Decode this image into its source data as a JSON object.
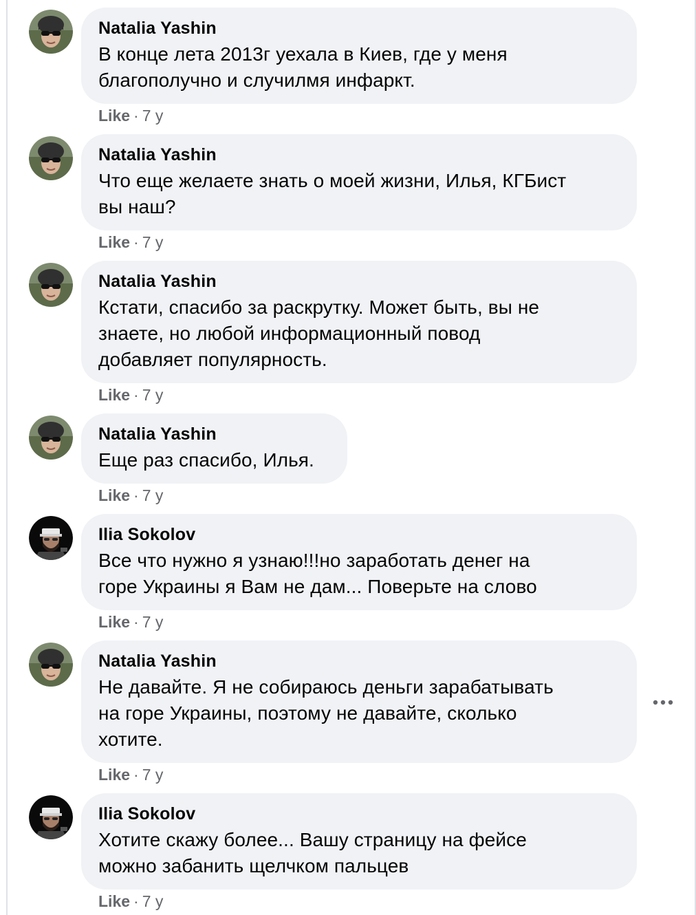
{
  "comments": [
    {
      "author": "Natalia Yashin",
      "text_lines": [
        "В конце лета 2013г уехала в Киев, где у меня",
        "благополучно и случилмя инфаркт."
      ],
      "like": "Like",
      "time": "7 y"
    },
    {
      "author": "Natalia Yashin",
      "text_lines": [
        "Что еще желаете знать о моей жизни, Илья, КГБист",
        "вы наш?"
      ],
      "like": "Like",
      "time": "7 y"
    },
    {
      "author": "Natalia Yashin",
      "text_lines": [
        "Кстати, спасибо за раскрутку. Может быть, вы не",
        "знаете, но любой информационный повод",
        "добавляет популярность."
      ],
      "like": "Like",
      "time": "7 y"
    },
    {
      "author": "Natalia Yashin",
      "text_lines": [
        "Еще раз спасибо, Илья."
      ],
      "like": "Like",
      "time": "7 y"
    },
    {
      "author": "Ilia Sokolov",
      "text_lines": [
        "Все что нужно я узнаю!!!но заработать денег на",
        "горе Украины я Вам не дам... Поверьте на слово"
      ],
      "like": "Like",
      "time": "7 y"
    },
    {
      "author": "Natalia Yashin",
      "text_lines": [
        "Не давайте. Я не собираюсь деньги зарабатывать",
        "на горе Украины, поэтому не давайте, сколько",
        "хотите."
      ],
      "like": "Like",
      "time": "7 y"
    },
    {
      "author": "Ilia Sokolov",
      "text_lines": [
        "Хотите скажу более... Вашу страницу на фейсе",
        "можно забанить щелчком пальцев"
      ],
      "like": "Like",
      "time": "7 y"
    }
  ],
  "separator": "·",
  "more_icon": "more-options-icon",
  "colors": {
    "bubble": "#f0f2f5",
    "text": "#050505",
    "meta": "#65676b"
  }
}
